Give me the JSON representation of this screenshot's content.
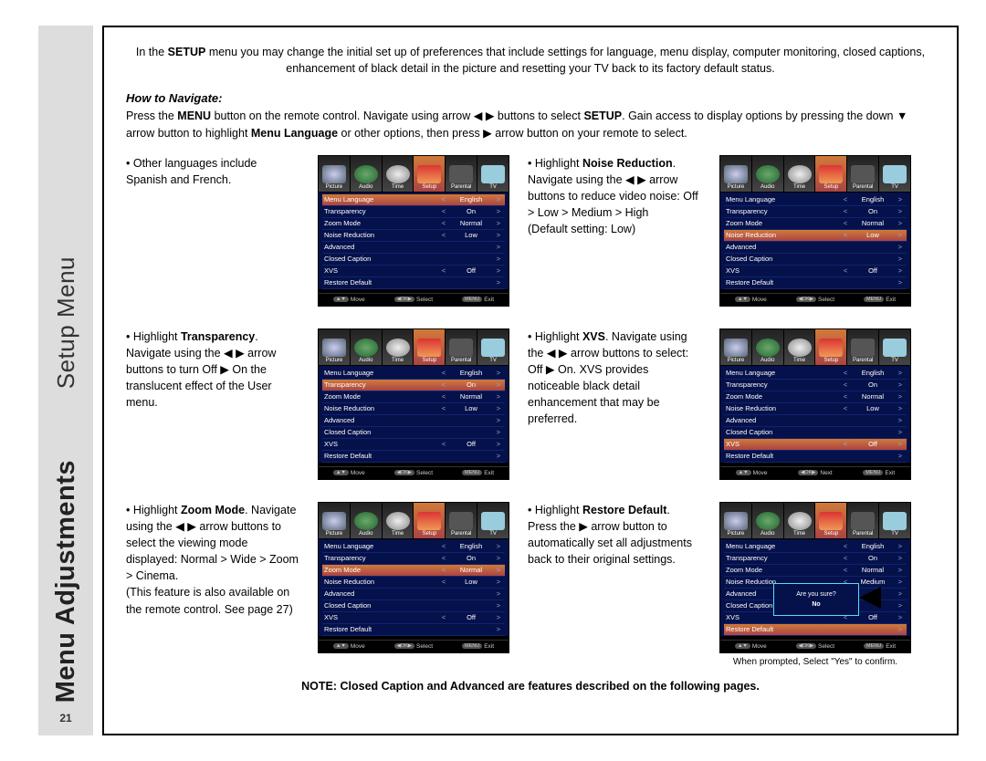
{
  "sidebar": {
    "line1": "Setup Menu",
    "line2_heavy": "Menu Adjustments",
    "page_number": "21"
  },
  "intro": {
    "prefix": "In the ",
    "bold1": "SETUP",
    "rest": " menu you may change the initial set up of preferences that include settings for language, menu display, computer monitoring, closed captions, enhancement of black detail in the picture and resetting your TV back to its factory default status."
  },
  "howto": {
    "title": "How to Navigate:",
    "a": "Press the ",
    "b": "MENU",
    "c": " button on the remote control. Navigate using arrow ◀ ▶ buttons to select ",
    "d": "SETUP",
    "e": ". Gain access to display options by pressing the down ▼ arrow button to highlight ",
    "f": "Menu Language",
    "g": " or other options, then press ▶ arrow button on your remote to select."
  },
  "items": [
    {
      "text_pre": "• Other languages include Spanish and French.",
      "bold": "",
      "text_post": "",
      "highlight_row": "Menu Language"
    },
    {
      "text_pre": "• Highlight ",
      "bold": "Noise Reduction",
      "text_post": ". Navigate using the ◀ ▶ arrow buttons to reduce video noise: Off > Low > Medium > High\n(Default setting: Low)",
      "highlight_row": "Noise Reduction"
    },
    {
      "text_pre": "• Highlight ",
      "bold": "Transparency",
      "text_post": ". Navigate using the ◀ ▶ arrow buttons to turn Off ▶ On the translucent effect of the User menu.",
      "highlight_row": "Transparency"
    },
    {
      "text_pre": "• Highlight ",
      "bold": "XVS",
      "text_post": ". Navigate using the ◀ ▶ arrow buttons to select: Off ▶ On. XVS provides noticeable black detail enhancement that may be preferred.",
      "highlight_row": "XVS"
    },
    {
      "text_pre": "• Highlight ",
      "bold": "Zoom Mode",
      "text_post": ". Navigate using the ◀ ▶ arrow buttons to select the viewing mode displayed: Normal > Wide > Zoom > Cinema.\n(This feature is also available on the remote control. See page 27)",
      "highlight_row": "Zoom Mode"
    },
    {
      "text_pre": "• Highlight ",
      "bold": "Restore Default",
      "text_post": ". Press the ▶ arrow button to automatically set all adjustments back to their original settings.",
      "highlight_row": "Restore Default",
      "caption": "When prompted, Select \"Yes\" to confirm.",
      "tv_special": "dialog"
    }
  ],
  "tv_tabs": [
    "Picture",
    "Audio",
    "Time",
    "Setup",
    "Parental",
    "TV"
  ],
  "tv_rows": [
    {
      "label": "Menu Language",
      "value": "English"
    },
    {
      "label": "Transparency",
      "value": "On"
    },
    {
      "label": "Zoom Mode",
      "value": "Normal"
    },
    {
      "label": "Noise Reduction",
      "value": "Low"
    },
    {
      "label": "Advanced",
      "value": ""
    },
    {
      "label": "Closed Caption",
      "value": ""
    },
    {
      "label": "XVS",
      "value": "Off"
    },
    {
      "label": "Restore Default",
      "value": ""
    }
  ],
  "tv_rows_restore": [
    {
      "label": "Menu Language",
      "value": "English"
    },
    {
      "label": "Transparency",
      "value": "On"
    },
    {
      "label": "Zoom Mode",
      "value": "Normal"
    },
    {
      "label": "Noise Reduction",
      "value": "Medium"
    },
    {
      "label": "Advanced",
      "value": ""
    },
    {
      "label": "Closed Caption",
      "value": ""
    },
    {
      "label": "XVS",
      "value": "Off"
    },
    {
      "label": "Restore Default",
      "value": ""
    }
  ],
  "tv_footer": {
    "move": "Move",
    "select": "Select",
    "next": "Next",
    "exit": "Exit",
    "menu": "MENU"
  },
  "dialog": {
    "q": "Are you sure?",
    "a": "No"
  },
  "note": "NOTE: Closed Caption and Advanced are features described on the following pages."
}
